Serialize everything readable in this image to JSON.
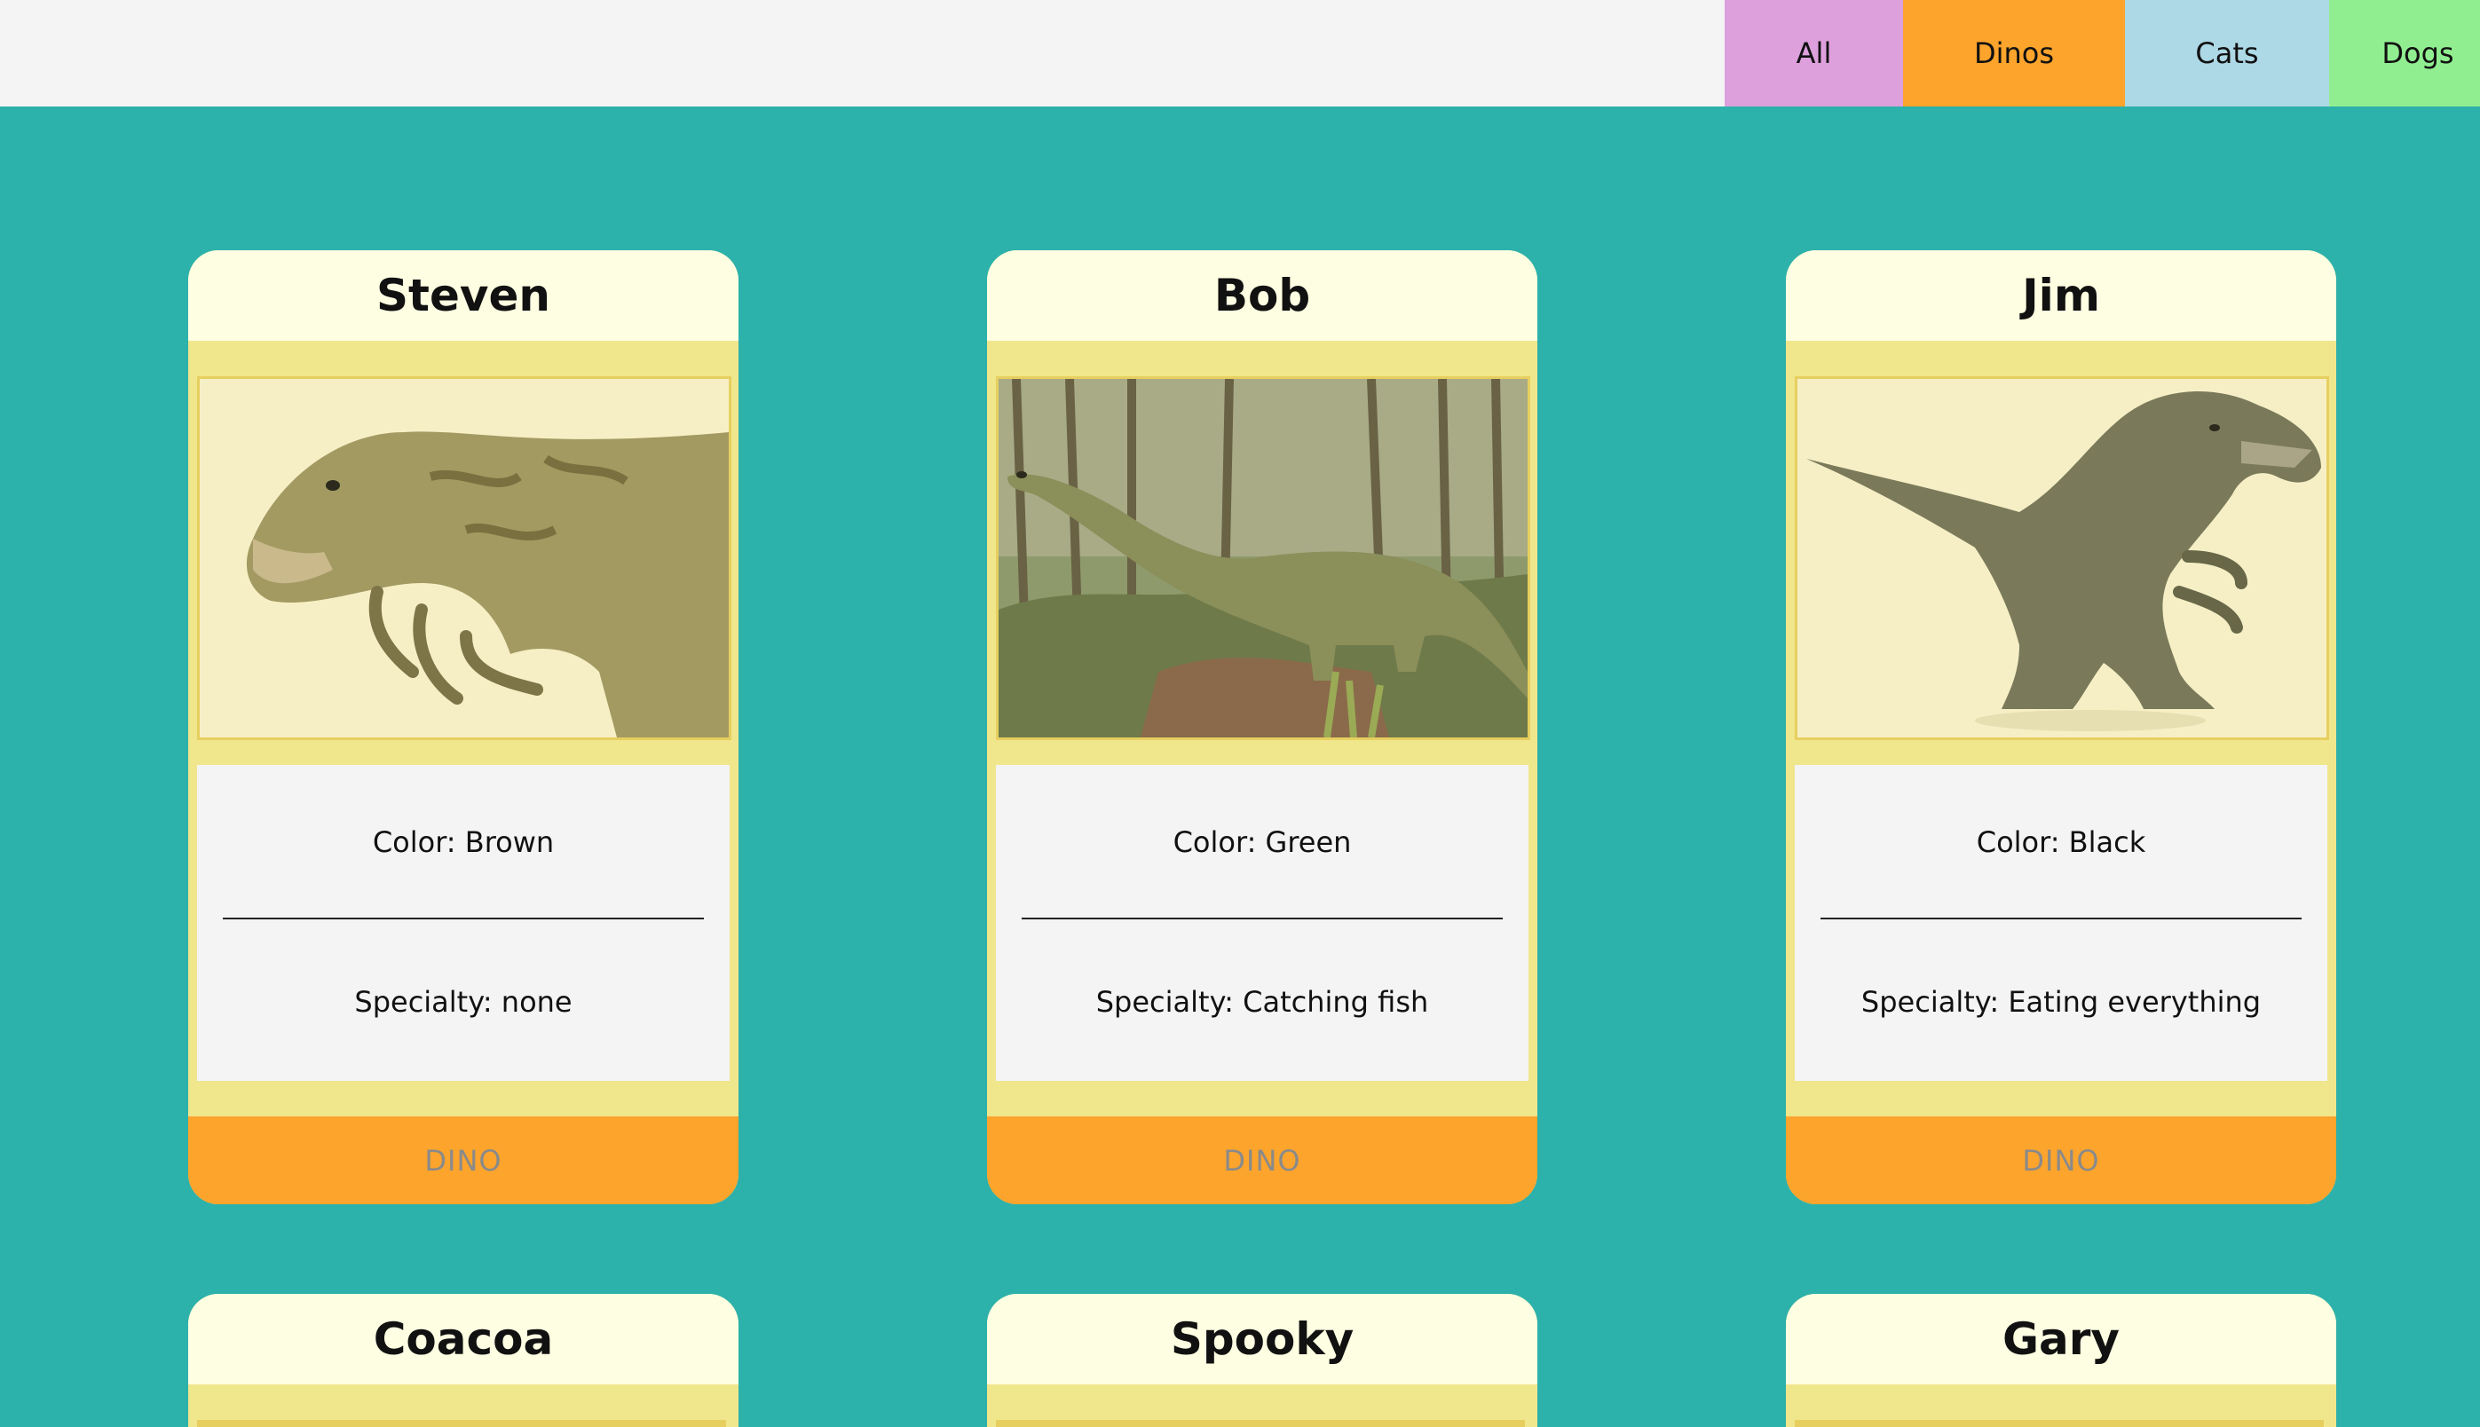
{
  "filters": {
    "all": "All",
    "dinos": "Dinos",
    "cats": "Cats",
    "dogs": "Dogs"
  },
  "colors": {
    "page_background": "#2db1ab",
    "topbar": "#f4f4f4",
    "all_button": "#dda0dd",
    "dinos_button": "#fca42c",
    "cats_button": "#add8e6",
    "dogs_button": "#90ee90",
    "card_body": "#f0e68c",
    "card_header": "#fefee2",
    "card_footer": "#fca42c"
  },
  "cards": [
    {
      "name": "Steven",
      "color_line": "Color: Brown",
      "specialty_line": "Specialty: none",
      "type": "DINO",
      "image": "raptor-dinosaur-photo"
    },
    {
      "name": "Bob",
      "color_line": "Color: Green",
      "specialty_line": "Specialty: Catching fish",
      "type": "DINO",
      "image": "long-neck-dinosaur-in-forest-photo"
    },
    {
      "name": "Jim",
      "color_line": "Color: Black",
      "specialty_line": "Specialty: Eating everything",
      "type": "DINO",
      "image": "t-rex-toy-photo"
    },
    {
      "name": "Coacoa"
    },
    {
      "name": "Spooky"
    },
    {
      "name": "Gary"
    }
  ]
}
